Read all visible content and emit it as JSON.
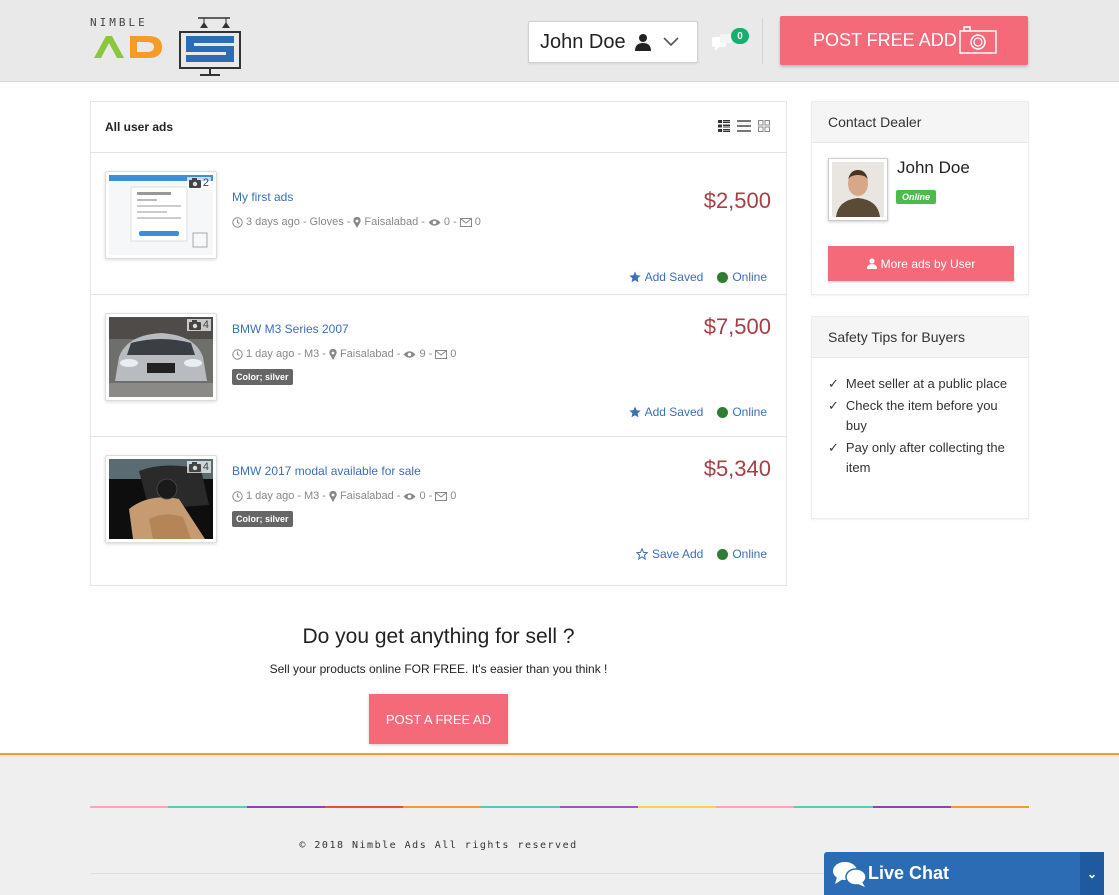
{
  "header": {
    "logo_top_text": "NIMBLE",
    "logo_main_text": "ADS",
    "user_name": "John Doe",
    "messages_count": "0",
    "post_button_label": "POST FREE ADD"
  },
  "listing": {
    "heading": "All user ads",
    "ads": [
      {
        "title": "My first ads",
        "time": "3 days ago",
        "category": "Gloves",
        "location": "Faisalabad",
        "views": "0",
        "messages": "0",
        "price": "$2,500",
        "photo_count": "2",
        "color_tag": "",
        "save_label": "Add Saved",
        "saved": true,
        "status": "Online"
      },
      {
        "title": "BMW M3 Series 2007",
        "time": "1 day ago",
        "category": "M3",
        "location": "Faisalabad",
        "views": "9",
        "messages": "0",
        "price": "$7,500",
        "photo_count": "4",
        "color_tag": "Color; silver",
        "save_label": "Add Saved",
        "saved": true,
        "status": "Online"
      },
      {
        "title": "BMW 2017 modal available for sale",
        "time": "1 day ago",
        "category": "M3",
        "location": "Faisalabad",
        "views": "0",
        "messages": "0",
        "price": "$5,340",
        "photo_count": "4",
        "color_tag": "Color; silver",
        "save_label": "Save Add",
        "saved": false,
        "status": "Online"
      }
    ]
  },
  "sidebar": {
    "contact_heading": "Contact Dealer",
    "dealer_name": "John Doe",
    "dealer_status": "Online",
    "more_ads_label": "More ads by User",
    "tips_heading": "Safety Tips for Buyers",
    "tips": [
      "Meet seller at a public place",
      "Check the item before you buy",
      "Pay only after collecting the item"
    ]
  },
  "promo": {
    "title": "Do you get anything for sell ?",
    "subtitle": "Sell your products online FOR FREE. It's easier than you think !",
    "button_label": "POST A FREE AD"
  },
  "footer": {
    "copyright": "© 2018 Nimble Ads All rights reserved",
    "live_chat_label": "Live Chat"
  },
  "colors": {
    "accent_pink": "#f46a79",
    "price_red": "#a44045",
    "link_blue": "#3c6fb5",
    "online_green": "#2e7d32",
    "footer_orange": "#f39c27",
    "live_chat_blue": "#2b6cb5"
  }
}
